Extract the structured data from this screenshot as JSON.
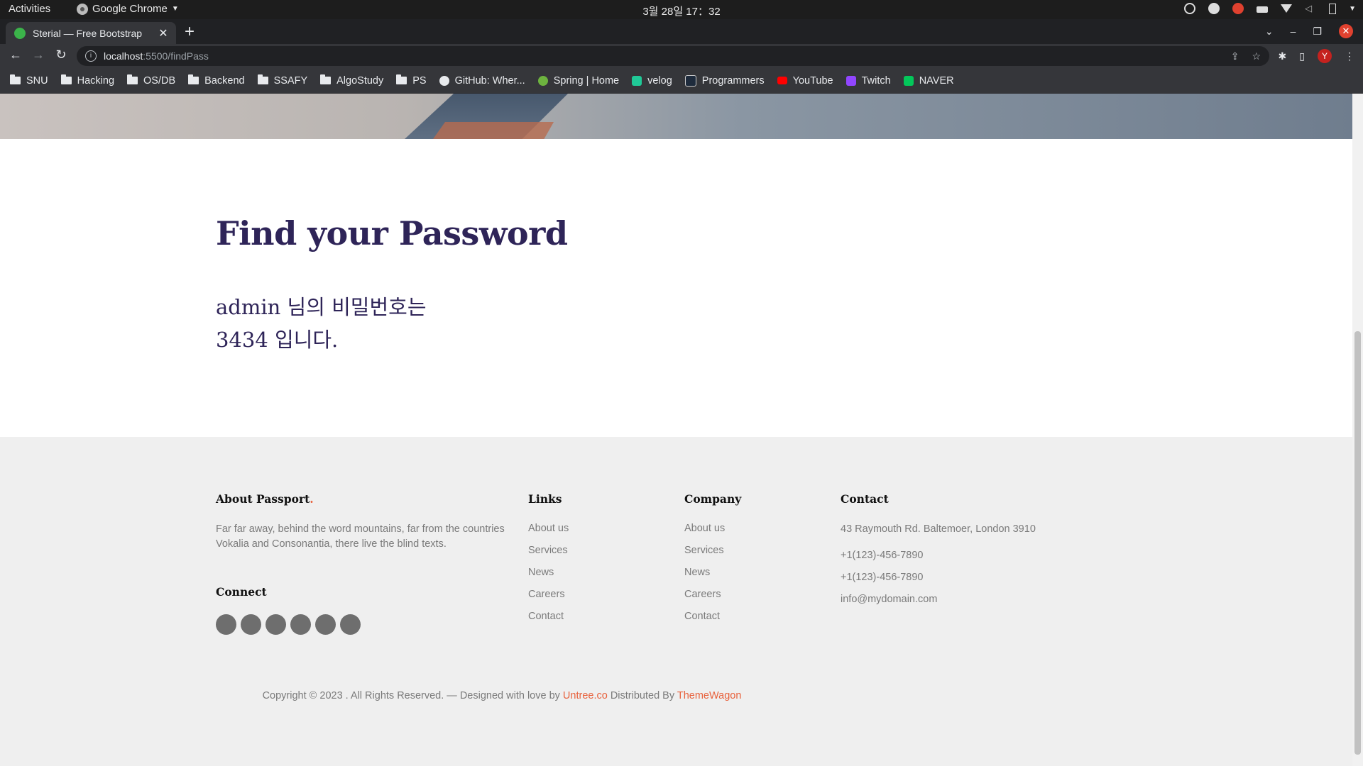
{
  "os_bar": {
    "activities": "Activities",
    "app_name": "Google Chrome",
    "clock": "3월 28일  17：32"
  },
  "browser": {
    "tab_title": "Sterial — Free Bootstrap",
    "url_host": "localhost",
    "url_path": ":5500/findPass",
    "avatar_letter": "Y",
    "bookmarks": [
      {
        "label": "SNU",
        "icon": "folder-icon"
      },
      {
        "label": "Hacking",
        "icon": "folder-icon"
      },
      {
        "label": "OS/DB",
        "icon": "folder-icon"
      },
      {
        "label": "Backend",
        "icon": "folder-icon"
      },
      {
        "label": "SSAFY",
        "icon": "folder-icon"
      },
      {
        "label": "AlgoStudy",
        "icon": "folder-icon"
      },
      {
        "label": "PS",
        "icon": "folder-icon"
      },
      {
        "label": "GitHub: Wher...",
        "icon": "github-icon"
      },
      {
        "label": "Spring | Home",
        "icon": "spring-icon"
      },
      {
        "label": "velog",
        "icon": "velog-icon"
      },
      {
        "label": "Programmers",
        "icon": "programmers-icon"
      },
      {
        "label": "YouTube",
        "icon": "youtube-icon"
      },
      {
        "label": "Twitch",
        "icon": "twitch-icon"
      },
      {
        "label": "NAVER",
        "icon": "naver-icon"
      }
    ]
  },
  "page": {
    "title": "Find your Password",
    "result_line1": "admin 님의 비밀번호는",
    "result_line2": "3434 입니다."
  },
  "footer": {
    "about_heading": "About Passport",
    "about_dot": ".",
    "about_text": "Far far away, behind the word mountains, far from the countries Vokalia and Consonantia, there live the blind texts.",
    "connect_heading": "Connect",
    "links_heading": "Links",
    "links": [
      "About us",
      "Services",
      "News",
      "Careers",
      "Contact"
    ],
    "company_heading": "Company",
    "company": [
      "About us",
      "Services",
      "News",
      "Careers",
      "Contact"
    ],
    "contact_heading": "Contact",
    "address": "43 Raymouth Rd. Baltemoer, London 3910",
    "phone1": "+1(123)-456-7890",
    "phone2": "+1(123)-456-7890",
    "email": "info@mydomain.com",
    "copyright_prefix": "Copyright © 2023 . All Rights Reserved. — Designed with love by ",
    "copyright_link1": "Untree.co",
    "copyright_mid": " Distributed By ",
    "copyright_link2": "ThemeWagon"
  },
  "colors": {
    "heading": "#2e2458",
    "accent": "#e8613c",
    "footer_bg": "#efefef"
  }
}
